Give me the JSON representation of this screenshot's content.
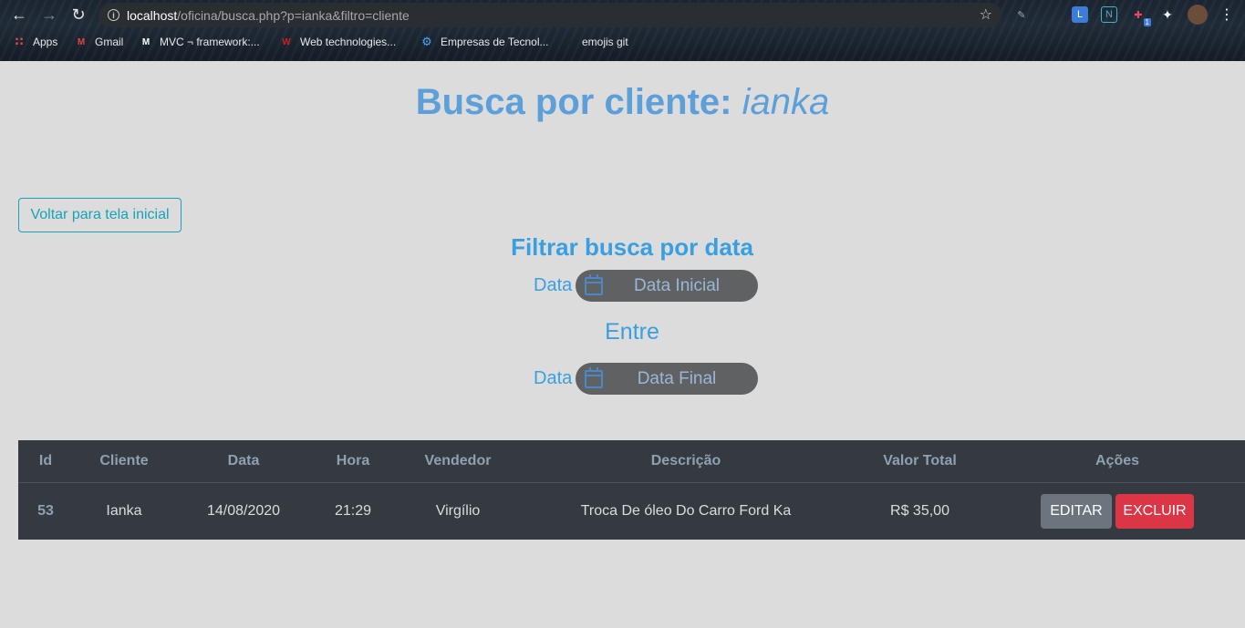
{
  "browser": {
    "url_host": "localhost",
    "url_path": "/oficina/busca.php?p=ianka&filtro=cliente",
    "bookmarks": [
      {
        "label": "Apps",
        "icon": "apps-grid-icon"
      },
      {
        "label": "Gmail",
        "icon": "gmail-icon"
      },
      {
        "label": "MVC ¬ framework:...",
        "icon": "medium-icon"
      },
      {
        "label": "Web technologies...",
        "icon": "w3schools-icon"
      },
      {
        "label": "Empresas de Tecnol...",
        "icon": "gear-icon"
      },
      {
        "label": "emojis git",
        "icon": "github-icon"
      }
    ],
    "extension_badge": "1"
  },
  "page": {
    "title_prefix": "Busca por cliente:",
    "title_term": "ianka",
    "back_button": "Voltar para tela inicial",
    "filter_title": "Filtrar busca por data",
    "date_label": "Data",
    "date_start_placeholder": "Data Inicial",
    "between_label": "Entre",
    "date_end_placeholder": "Data Final"
  },
  "table": {
    "headers": [
      "Id",
      "Cliente",
      "Data",
      "Hora",
      "Vendedor",
      "Descrição",
      "Valor Total",
      "Ações"
    ],
    "rows": [
      {
        "id": "53",
        "cliente": "Ianka",
        "data": "14/08/2020",
        "hora": "21:29",
        "vendedor": "Virgílio",
        "descricao": "Troca De óleo Do Carro Ford Ka",
        "valor": "R$ 35,00",
        "edit_label": "EDITAR",
        "delete_label": "EXCLUIR"
      }
    ]
  },
  "colors": {
    "title": "#5d9fd9",
    "accent": "#3a9fe0",
    "outline_button": "#17a2b8",
    "table_bg": "#343a40",
    "edit_button": "#6c757d",
    "delete_button": "#dc3545"
  }
}
